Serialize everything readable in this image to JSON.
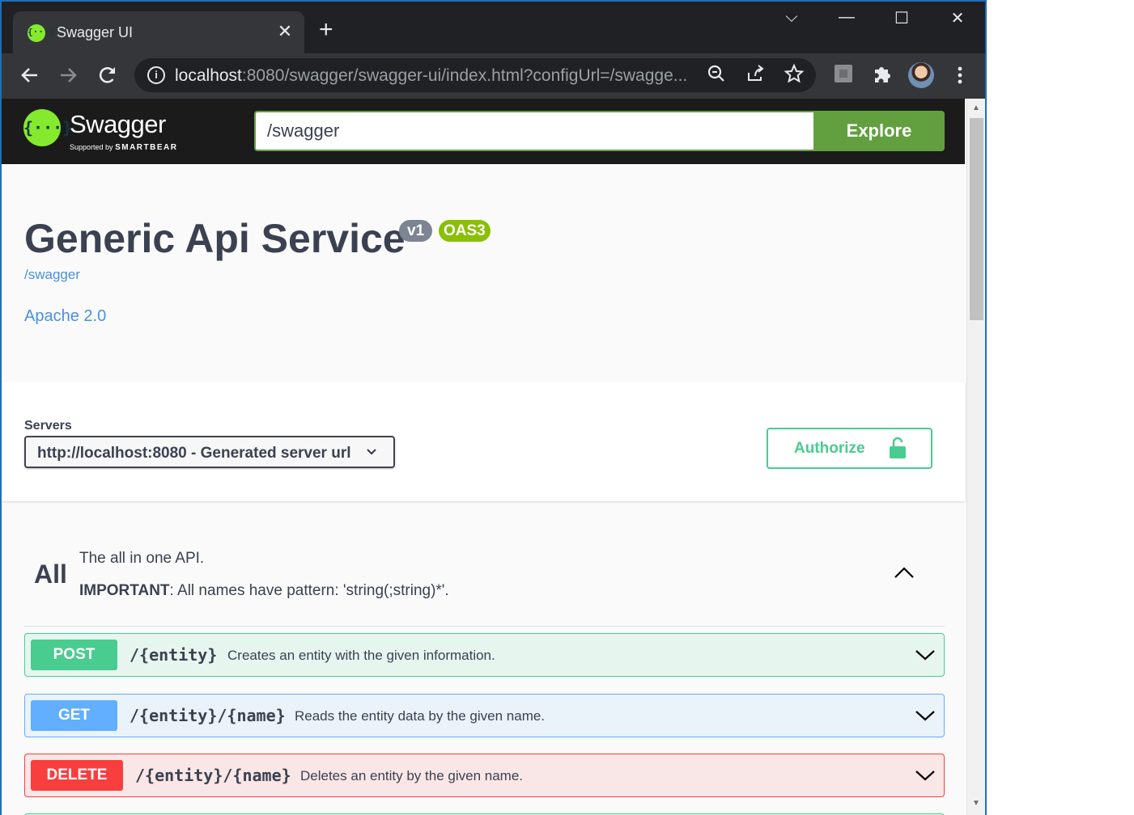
{
  "browser": {
    "tab_title": "Swagger UI",
    "tab_close": "✕",
    "new_tab": "+",
    "url_host": "localhost",
    "url_rest": ":8080/swagger/swagger-ui/index.html?configUrl=/swagge...",
    "window_controls": {
      "tab_search": "⌵",
      "minimize": "—",
      "maximize": "☐",
      "close": "✕"
    },
    "toolbar_icons": [
      "back-icon",
      "forward-icon",
      "reload-icon",
      "zoom-icon",
      "share-icon",
      "bookmark-star-icon",
      "extension-icon",
      "puzzle-icon",
      "avatar",
      "menu-icon"
    ]
  },
  "topbar": {
    "logo_mark": "{···}",
    "logo_name": "Swagger",
    "logo_supported": "Supported by",
    "logo_brand": "SMARTBEAR",
    "spec_value": "/swagger",
    "explore_label": "Explore",
    "brand_color": "#62a03f"
  },
  "info": {
    "title": "Generic Api Service",
    "version_badge": "v1",
    "oas_badge": "OAS3",
    "spec_url": "/swagger",
    "license": "Apache 2.0"
  },
  "scheme": {
    "servers_label": "Servers",
    "selected_server": "http://localhost:8080 - Generated server url",
    "authorize_label": "Authorize"
  },
  "tag": {
    "name": "All",
    "description": "The all in one API.",
    "important_label": "IMPORTANT",
    "important_text": ": All names have pattern: 'string(;string)*'."
  },
  "operations": [
    {
      "method": "POST",
      "path": "/{entity}",
      "summary": "Creates an entity with the given information.",
      "color": "#49cc90"
    },
    {
      "method": "GET",
      "path": "/{entity}/{name}",
      "summary": "Reads the entity data by the given name.",
      "color": "#61affe"
    },
    {
      "method": "DELETE",
      "path": "/{entity}/{name}",
      "summary": "Deletes an entity by the given name.",
      "color": "#f93e3e"
    }
  ]
}
